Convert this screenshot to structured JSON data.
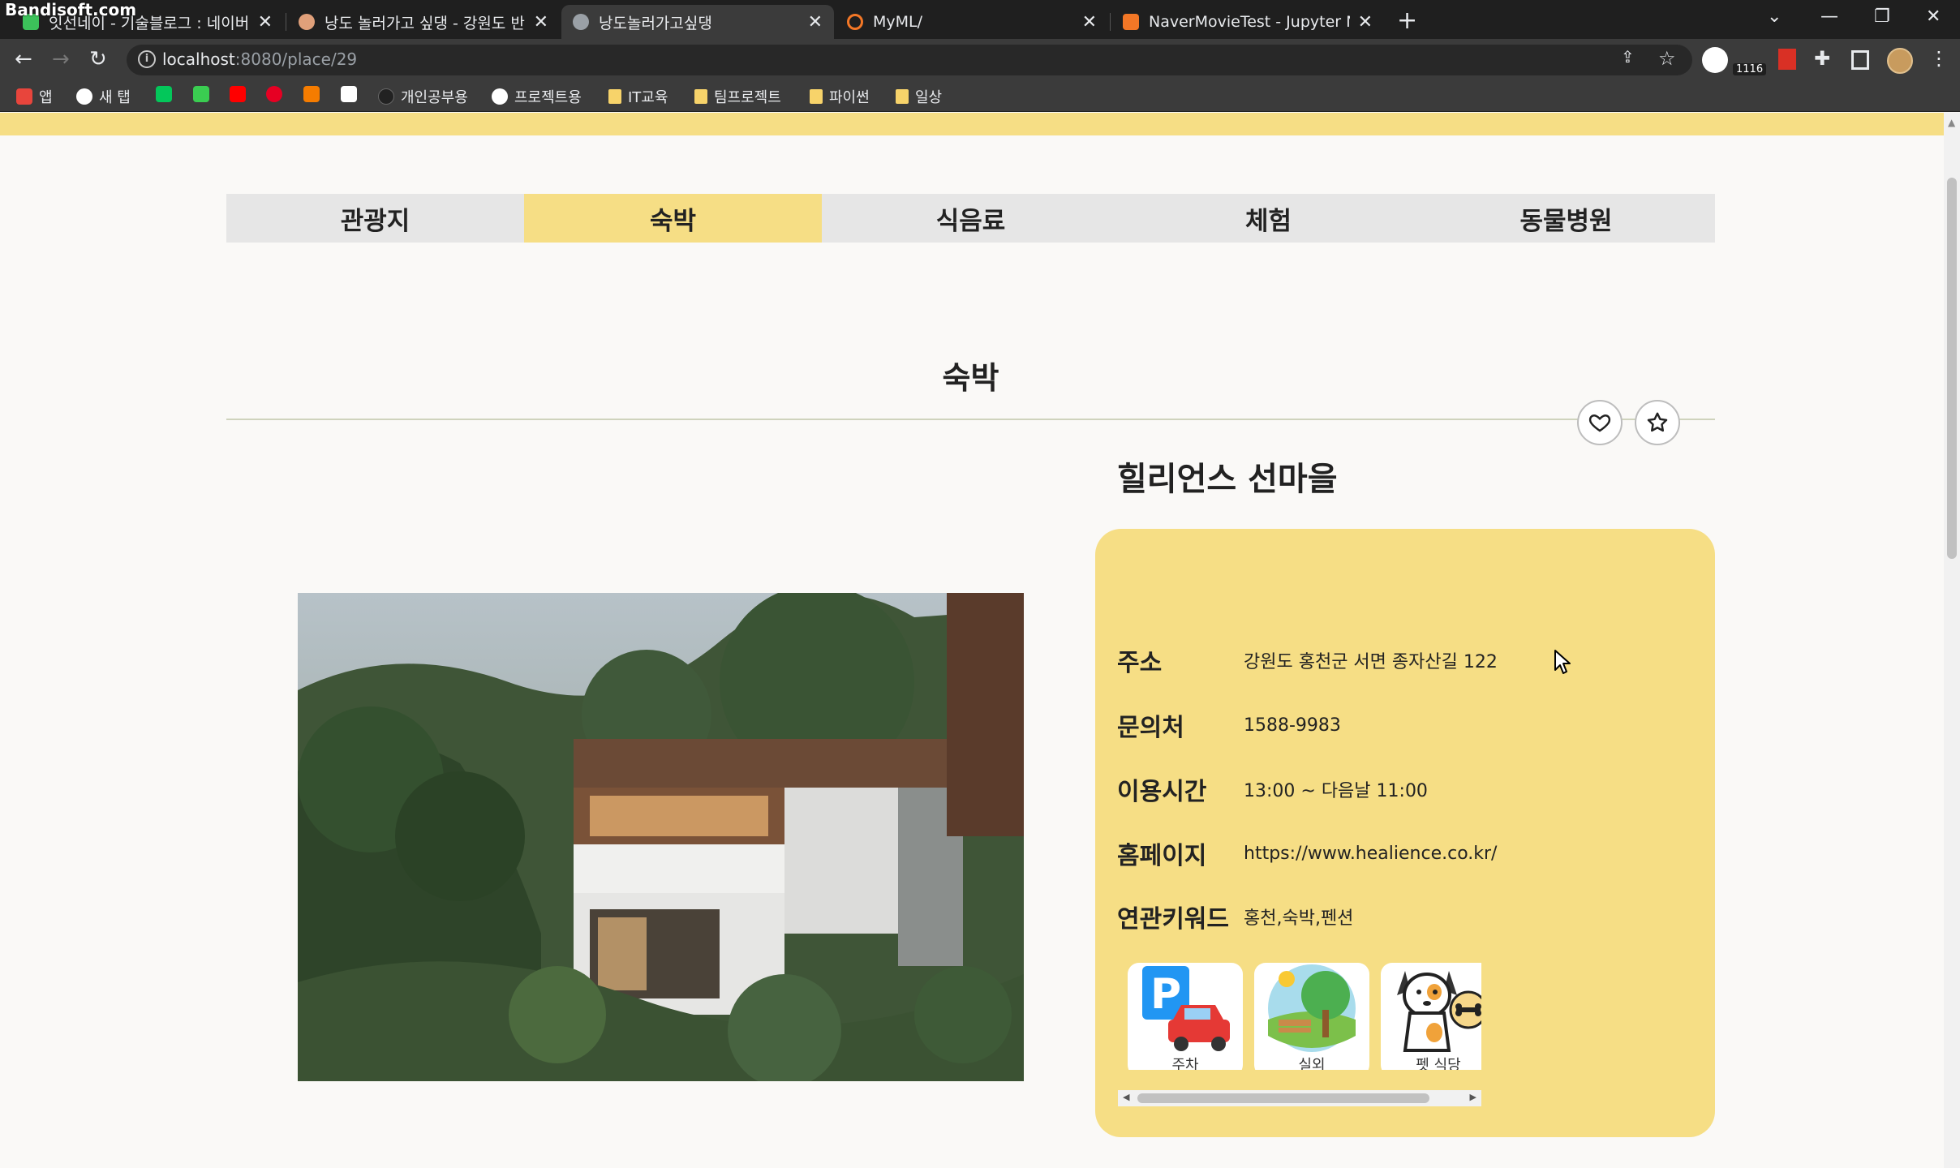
{
  "recorder_watermark": "Bandisoft.com",
  "browser": {
    "tabs": [
      {
        "title": "잇선네이 - 기술블로그 : 네이버",
        "active": false,
        "favicon_color": "#3cc25a"
      },
      {
        "title": "낭도 놀러가고 싶댕 - 강원도 반려",
        "active": false,
        "favicon_color": "#e0a07a"
      },
      {
        "title": "낭도놀러가고싶댕",
        "active": true,
        "favicon_color": "#9aa0a6"
      },
      {
        "title": "MyML/",
        "active": false,
        "favicon_color": "#f37726"
      },
      {
        "title": "NaverMovieTest - Jupyter Notebook",
        "active": false,
        "favicon_color": "#f37726"
      }
    ],
    "new_tab_label": "+",
    "url_host": "localhost",
    "url_rest": ":8080/place/29",
    "extension_badge": "1116",
    "bookmarks": [
      {
        "label": "앱",
        "icon": "apps-grid-icon",
        "color": "#e8453c"
      },
      {
        "label": "새 탭",
        "icon": "globe-icon",
        "color": "#ffffff"
      },
      {
        "label": "",
        "icon": "naver-icon",
        "color": "#03c75a"
      },
      {
        "label": "",
        "icon": "line-icon",
        "color": "#3acd51"
      },
      {
        "label": "",
        "icon": "youtube-icon",
        "color": "#ff0000"
      },
      {
        "label": "",
        "icon": "pinterest-icon",
        "color": "#e60023"
      },
      {
        "label": "",
        "icon": "app-icon",
        "color": "#f57c00"
      },
      {
        "label": "",
        "icon": "trello-icon",
        "color": "#ffffff"
      },
      {
        "label": "개인공부용",
        "icon": "github-icon",
        "color": "#222222"
      },
      {
        "label": "프로젝트용",
        "icon": "github-icon",
        "color": "#ffffff"
      },
      {
        "label": "IT교육",
        "icon": "folder-icon",
        "color": "#f7d36a"
      },
      {
        "label": "팀프로젝트",
        "icon": "folder-icon",
        "color": "#f7d36a"
      },
      {
        "label": "파이썬",
        "icon": "folder-icon",
        "color": "#f7d36a"
      },
      {
        "label": "일상",
        "icon": "folder-icon",
        "color": "#f7d36a"
      }
    ]
  },
  "page": {
    "accent_color": "#f6de85",
    "categories": [
      {
        "label": "관광지",
        "active": false
      },
      {
        "label": "숙박",
        "active": true
      },
      {
        "label": "식음료",
        "active": false
      },
      {
        "label": "체험",
        "active": false
      },
      {
        "label": "동물병원",
        "active": false
      }
    ],
    "section_title": "숙박",
    "place": {
      "name": "힐리언스 선마을",
      "rows": [
        {
          "label": "주소",
          "value": "강원도 홍천군 서면 종자산길 122"
        },
        {
          "label": "문의처",
          "value": "1588-9983"
        },
        {
          "label": "이용시간",
          "value": "13:00 ~ 다음날 11:00"
        },
        {
          "label": "홈페이지",
          "value": "https://www.healience.co.kr/"
        },
        {
          "label": "연관키워드",
          "value": "홍천,숙박,펜션"
        }
      ],
      "amenities": [
        {
          "label": "주차",
          "icon": "parking-icon"
        },
        {
          "label": "실외",
          "icon": "outdoor-park-icon"
        },
        {
          "label": "펫 식당",
          "icon": "pet-restaurant-icon"
        }
      ]
    }
  }
}
